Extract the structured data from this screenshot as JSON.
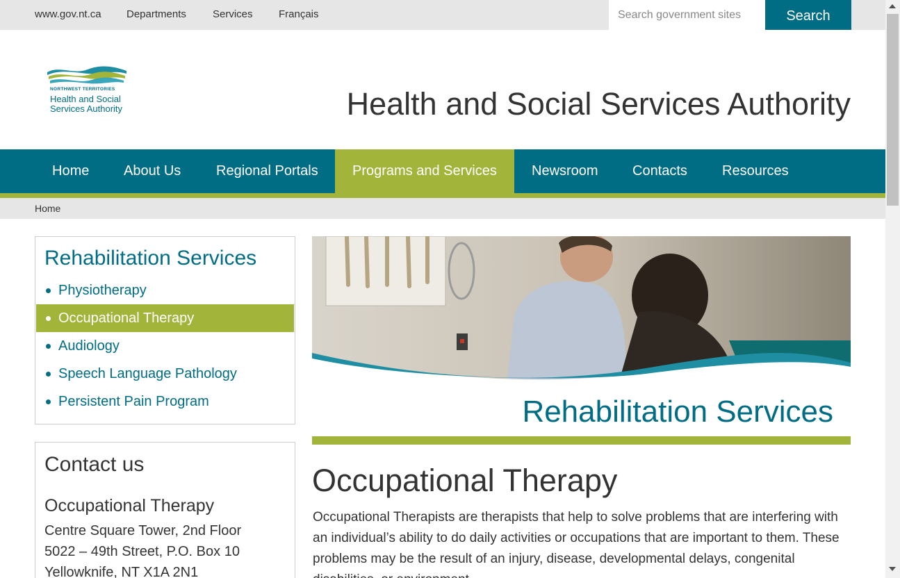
{
  "util_bar": {
    "links": [
      "www.gov.nt.ca",
      "Departments",
      "Services",
      "Français"
    ],
    "search_placeholder": "Search government sites",
    "search_button": "Search"
  },
  "header": {
    "logo_small": "NORTHWEST TERRITORIES",
    "logo_name": "Health and Social Services Authority",
    "site_title": "Health and Social Services Authority"
  },
  "nav": {
    "items": [
      "Home",
      "About Us",
      "Regional Portals",
      "Programs and Services",
      "Newsroom",
      "Contacts",
      "Resources"
    ],
    "active": "Programs and Services"
  },
  "breadcrumb": {
    "home": "Home"
  },
  "side_menu": {
    "title": "Rehabilitation Services",
    "items": [
      "Physiotherapy",
      "Occupational Therapy",
      "Audiology",
      "Speech Language Pathology",
      "Persistent Pain Program"
    ],
    "active": "Occupational Therapy"
  },
  "contact": {
    "title": "Contact us",
    "subtitle": "Occupational Therapy",
    "lines": [
      "Centre Square Tower, 2nd Floor",
      "5022 – 49th Street, P.O. Box 10",
      "Yellowknife, NT X1A 2N1"
    ]
  },
  "banner": {
    "title": "Rehabilitation Services"
  },
  "main": {
    "page_title": "Occupational Therapy",
    "body": "Occupational Therapists are therapists that help to solve problems that are interfering with an individual’s ability to do daily activities or occupations that are important to them.  These problems may be the result of an injury, disease, developmental delays, congenital disabilities, or environment."
  },
  "colors": {
    "teal": "#006d85",
    "green": "#a2b53a",
    "gray_bar": "#e6e6e6"
  }
}
